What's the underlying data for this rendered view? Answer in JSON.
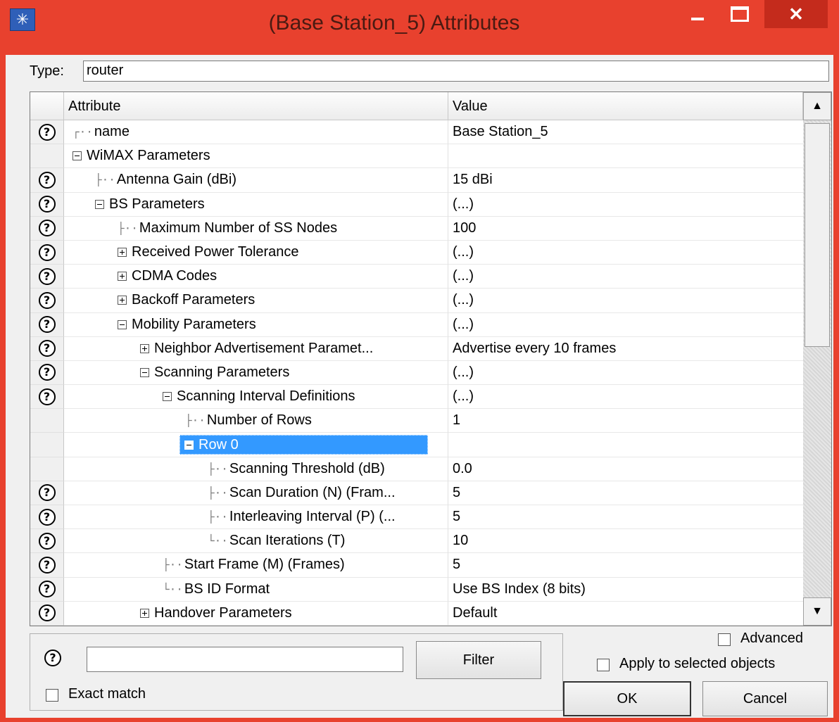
{
  "window": {
    "title": "(Base Station_5) Attributes",
    "close_glyph": "✕",
    "icon": "star-app-icon"
  },
  "type": {
    "label": "Type:",
    "value": "router"
  },
  "table": {
    "headers": [
      "Attribute",
      "Value"
    ],
    "rows": [
      {
        "help": true,
        "tree": "┌··",
        "expander": "",
        "label": "name",
        "value": "Base Station_5",
        "indent": 0
      },
      {
        "help": false,
        "tree": "",
        "expander": "minus",
        "label": "WiMAX Parameters",
        "value": "",
        "indent": 0
      },
      {
        "help": true,
        "tree": "├··",
        "expander": "",
        "label": "Antenna Gain (dBi)",
        "value": "15 dBi",
        "indent": 1
      },
      {
        "help": true,
        "tree": "",
        "expander": "minus",
        "label": "BS Parameters",
        "value": "(...)",
        "indent": 1
      },
      {
        "help": true,
        "tree": "├··",
        "expander": "",
        "label": "Maximum Number of SS Nodes",
        "value": "100",
        "indent": 2
      },
      {
        "help": true,
        "tree": "",
        "expander": "plus",
        "label": "Received Power Tolerance",
        "value": "(...)",
        "indent": 2
      },
      {
        "help": true,
        "tree": "",
        "expander": "plus",
        "label": "CDMA Codes",
        "value": "(...)",
        "indent": 2
      },
      {
        "help": true,
        "tree": "",
        "expander": "plus",
        "label": "Backoff Parameters",
        "value": "(...)",
        "indent": 2
      },
      {
        "help": true,
        "tree": "",
        "expander": "minus",
        "label": "Mobility Parameters",
        "value": "(...)",
        "indent": 2
      },
      {
        "help": true,
        "tree": "",
        "expander": "plus",
        "label": "Neighbor Advertisement Paramet...",
        "value": "Advertise every 10 frames",
        "indent": 3
      },
      {
        "help": true,
        "tree": "",
        "expander": "minus",
        "label": "Scanning Parameters",
        "value": "(...)",
        "indent": 3
      },
      {
        "help": true,
        "tree": "",
        "expander": "minus",
        "label": "Scanning Interval Definitions",
        "value": "(...)",
        "indent": 4
      },
      {
        "help": false,
        "tree": "├··",
        "expander": "",
        "label": "Number of Rows",
        "value": "1",
        "indent": 5
      },
      {
        "help": false,
        "tree": "",
        "expander": "minus",
        "label": "Row 0",
        "value": "",
        "indent": 5,
        "selected": true
      },
      {
        "help": false,
        "tree": "├··",
        "expander": "",
        "label": "Scanning Threshold (dB)",
        "value": "0.0",
        "indent": 6
      },
      {
        "help": true,
        "tree": "├··",
        "expander": "",
        "label": "Scan Duration (N) (Fram...",
        "value": "5",
        "indent": 6
      },
      {
        "help": true,
        "tree": "├··",
        "expander": "",
        "label": "Interleaving Interval (P) (...",
        "value": "5",
        "indent": 6
      },
      {
        "help": true,
        "tree": "└··",
        "expander": "",
        "label": "Scan Iterations (T)",
        "value": "10",
        "indent": 6
      },
      {
        "help": true,
        "tree": "├··",
        "expander": "",
        "label": "Start Frame (M) (Frames)",
        "value": "5",
        "indent": 4
      },
      {
        "help": true,
        "tree": "└··",
        "expander": "",
        "label": "BS ID Format",
        "value": "Use BS Index (8 bits)",
        "indent": 4
      },
      {
        "help": true,
        "tree": "",
        "expander": "plus",
        "label": "Handover Parameters",
        "value": "Default",
        "indent": 3
      }
    ]
  },
  "help_glyph": "?",
  "scroll": {
    "up": "▲",
    "down": "▼"
  },
  "filter": {
    "value": "",
    "button": "Filter",
    "exact_match": "Exact match"
  },
  "options": {
    "advanced": "Advanced",
    "apply_selected": "Apply to selected objects"
  },
  "buttons": {
    "ok": "OK",
    "cancel": "Cancel"
  }
}
